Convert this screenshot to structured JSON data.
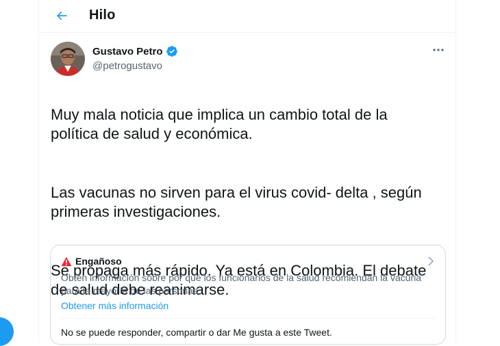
{
  "header": {
    "title": "Hilo",
    "back_icon": "arrow-left-icon"
  },
  "tweet": {
    "author_name": "Gustavo Petro",
    "author_handle": "@petrogustavo",
    "verified_icon": "verified-badge-icon",
    "paragraphs": [
      "Muy mala noticia que implica un cambio total de la\npolítica de salud y económica.",
      "Las vacunas no sirven para el virus covid- delta , según\nprimeras investigaciones.",
      "Se propaga más rápido. Ya está en Colombia. El debate\nde salud debe reanimarse."
    ]
  },
  "notice": {
    "title": "Engañoso",
    "body": "Obtén información sobre por qué los funcionarios de la salud recomiendan la vacuna para la mayoría de las personas.",
    "link": "Obtener más información",
    "footer": "No se puede responder, compartir o dar Me gusta a este Tweet."
  },
  "colors": {
    "accent": "#1d9bf0",
    "warning": "#f4212e",
    "secondary_text": "#536471"
  }
}
